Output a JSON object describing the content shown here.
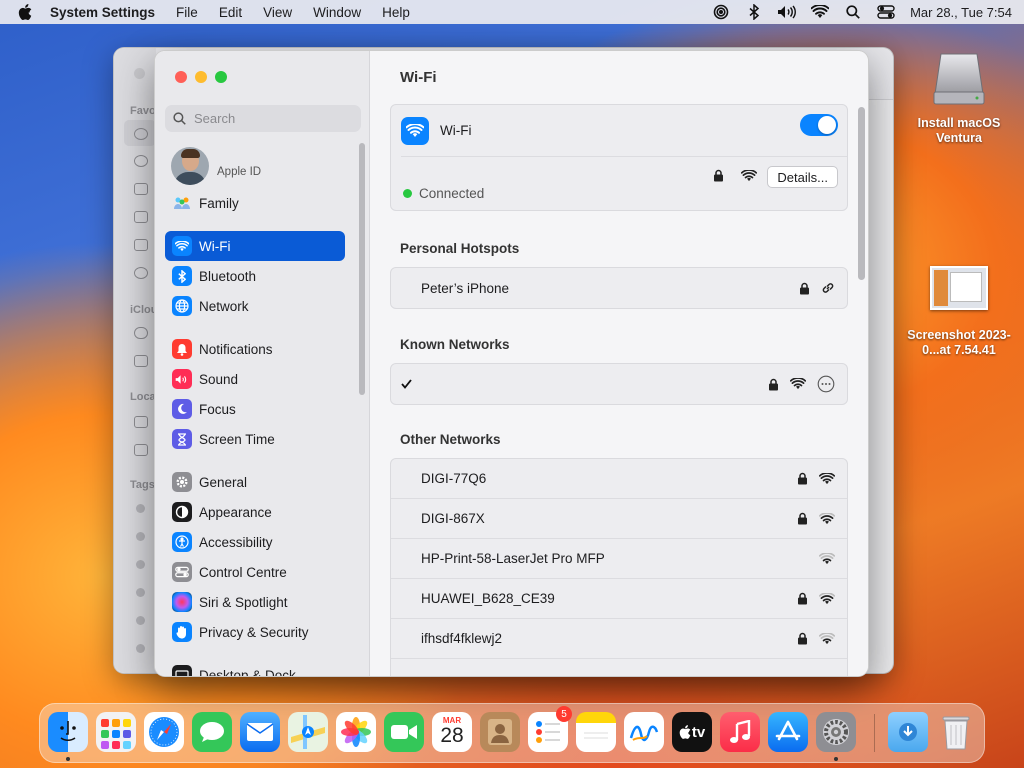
{
  "menubar": {
    "app": "System Settings",
    "menus": [
      "File",
      "Edit",
      "View",
      "Window",
      "Help"
    ],
    "clock": "Mar 28., Tue  7:54",
    "status_icons": [
      "airdrop-icon",
      "bluetooth-icon",
      "volume-icon",
      "wifi-icon",
      "search-icon",
      "control-center-icon"
    ]
  },
  "desktop": {
    "icons": [
      {
        "label": "Install macOS Ventura",
        "icon": "installer-disk-icon"
      },
      {
        "label": "Screenshot 2023-0...at 7.54.41",
        "icon": "screenshot-file-icon"
      }
    ]
  },
  "sidebar": {
    "search_placeholder": "Search",
    "apple_id_label": "Apple ID",
    "family": "Family",
    "items": [
      {
        "label": "Wi-Fi",
        "icon": "wifi-icon",
        "color": "#0a84ff",
        "selected": true
      },
      {
        "label": "Bluetooth",
        "icon": "bluetooth-icon",
        "color": "#0a84ff"
      },
      {
        "label": "Network",
        "icon": "globe-icon",
        "color": "#0a84ff"
      },
      {
        "label": "Notifications",
        "icon": "bell-icon",
        "color": "#ff3b30"
      },
      {
        "label": "Sound",
        "icon": "speaker-icon",
        "color": "#ff2d55"
      },
      {
        "label": "Focus",
        "icon": "moon-icon",
        "color": "#5e5ce6"
      },
      {
        "label": "Screen Time",
        "icon": "hourglass-icon",
        "color": "#5e5ce6"
      },
      {
        "label": "General",
        "icon": "gear-icon",
        "color": "#8e8e93"
      },
      {
        "label": "Appearance",
        "icon": "appearance-icon",
        "color": "#1c1c1e"
      },
      {
        "label": "Accessibility",
        "icon": "accessibility-icon",
        "color": "#0a84ff"
      },
      {
        "label": "Control Centre",
        "icon": "control-centre-icon",
        "color": "#8e8e93"
      },
      {
        "label": "Siri & Spotlight",
        "icon": "siri-icon",
        "color": "#2d2d6e"
      },
      {
        "label": "Privacy & Security",
        "icon": "hand-icon",
        "color": "#0a84ff"
      },
      {
        "label": "Desktop & Dock",
        "icon": "desktop-icon",
        "color": "#1c1c1e"
      }
    ]
  },
  "content": {
    "title": "Wi-Fi",
    "wifi_label": "Wi-Fi",
    "wifi_on": true,
    "connected_status": "Connected",
    "details_button": "Details...",
    "personal_hotspots_title": "Personal Hotspots",
    "hotspots": [
      {
        "name": "Peter’s iPhone"
      }
    ],
    "known_networks_title": "Known Networks",
    "known_networks": [
      {
        "name": "",
        "checked": true
      }
    ],
    "other_networks_title": "Other Networks",
    "other_networks": [
      {
        "name": "DIGI-77Q6",
        "locked": true,
        "signal": "strong"
      },
      {
        "name": "DIGI-867X",
        "locked": true,
        "signal": "medium"
      },
      {
        "name": "HP-Print-58-LaserJet Pro MFP",
        "locked": false,
        "signal": "weak"
      },
      {
        "name": "HUAWEI_B628_CE39",
        "locked": true,
        "signal": "medium"
      },
      {
        "name": "ifhsdf4fklewj2",
        "locked": true,
        "signal": "weak"
      }
    ]
  },
  "dock": {
    "calendar_month": "MAR",
    "calendar_day": "28",
    "reminders_badge": "5",
    "tv_label": "tv"
  }
}
